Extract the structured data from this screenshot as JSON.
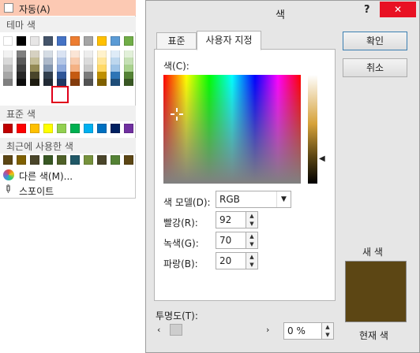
{
  "palette": {
    "automatic_label": "자동(A)",
    "theme_title": "테마 색",
    "standard_title": "표준 색",
    "recent_title": "최근에 사용한 색",
    "more_colors_label": "다른 색(M)...",
    "eyedropper_label": "스포이트",
    "theme_top": [
      "#ffffff",
      "#000000",
      "#e7e6e6",
      "#44546a",
      "#4472c4",
      "#ed7d31",
      "#a5a5a5",
      "#ffc000",
      "#5b9bd5",
      "#70ad47",
      "#f79646",
      "#4bacc6",
      "#9bbb59",
      "#8064a2",
      "#c0504d",
      "#e36c09"
    ],
    "theme_columns": [
      [
        "#f2f2f2",
        "#d9d9d9",
        "#bfbfbf",
        "#a6a6a6",
        "#808080"
      ],
      [
        "#7f7f7f",
        "#595959",
        "#3f3f3f",
        "#262626",
        "#0d0d0d"
      ],
      [
        "#d6d1c1",
        "#c4bd97",
        "#948a54",
        "#4a452a",
        "#1e1c11"
      ],
      [
        "#d5dce4",
        "#adb9ca",
        "#8497b0",
        "#323f4f",
        "#222a35"
      ],
      [
        "#dae3f3",
        "#b4c7e7",
        "#8faadc",
        "#2f5597",
        "#1f3864"
      ],
      [
        "#fbe5d6",
        "#f8cbad",
        "#f4b183",
        "#c55a11",
        "#843c0c"
      ],
      [
        "#ededed",
        "#dbdbdb",
        "#c9c9c9",
        "#7b7b7b",
        "#525252"
      ],
      [
        "#fff2cc",
        "#ffe699",
        "#ffd966",
        "#bf9000",
        "#7f6000"
      ],
      [
        "#deebf7",
        "#bdd7ee",
        "#9dc3e6",
        "#2e75b6",
        "#1f4e79"
      ],
      [
        "#e2f0d9",
        "#c5e0b4",
        "#a9d18e",
        "#548235",
        "#385723"
      ],
      [
        "#fde9d9",
        "#fbd5b5",
        "#fac08f",
        "#e36c09",
        "#974806"
      ],
      [
        "#daeef3",
        "#b7dde8",
        "#92cddc",
        "#31859c",
        "#205867"
      ],
      [
        "#ebf1dd",
        "#d7e3bc",
        "#c3d69b",
        "#76923c",
        "#4f6128"
      ]
    ],
    "standard_colors": [
      "#c00000",
      "#ff0000",
      "#ffc000",
      "#ffff00",
      "#92d050",
      "#00b050",
      "#00b0f0",
      "#0070c0",
      "#002060",
      "#7030a0"
    ],
    "recent_colors": [
      "#5c4614",
      "#7f6000",
      "#4a452a",
      "#385723",
      "#4f6128",
      "#205867",
      "#76923c",
      "#4a452a",
      "#548235",
      "#5c4614"
    ]
  },
  "dialog": {
    "title": "색",
    "help_btn": "?",
    "close_btn": "✕",
    "tabs": [
      "표준",
      "사용자 지정"
    ],
    "ok_label": "확인",
    "cancel_label": "취소",
    "colors_label": "색(C):",
    "model_label": "색 모델(D):",
    "model_value": "RGB",
    "red_label": "빨강(R):",
    "red_value": "92",
    "green_label": "녹색(G):",
    "green_value": "70",
    "blue_label": "파랑(B):",
    "blue_value": "20",
    "transparency_label": "투명도(T):",
    "transparency_value": "0 %",
    "new_label": "새 색",
    "current_label": "현재 색",
    "new_color": "#5c4614",
    "accent_close": "#e81123"
  }
}
